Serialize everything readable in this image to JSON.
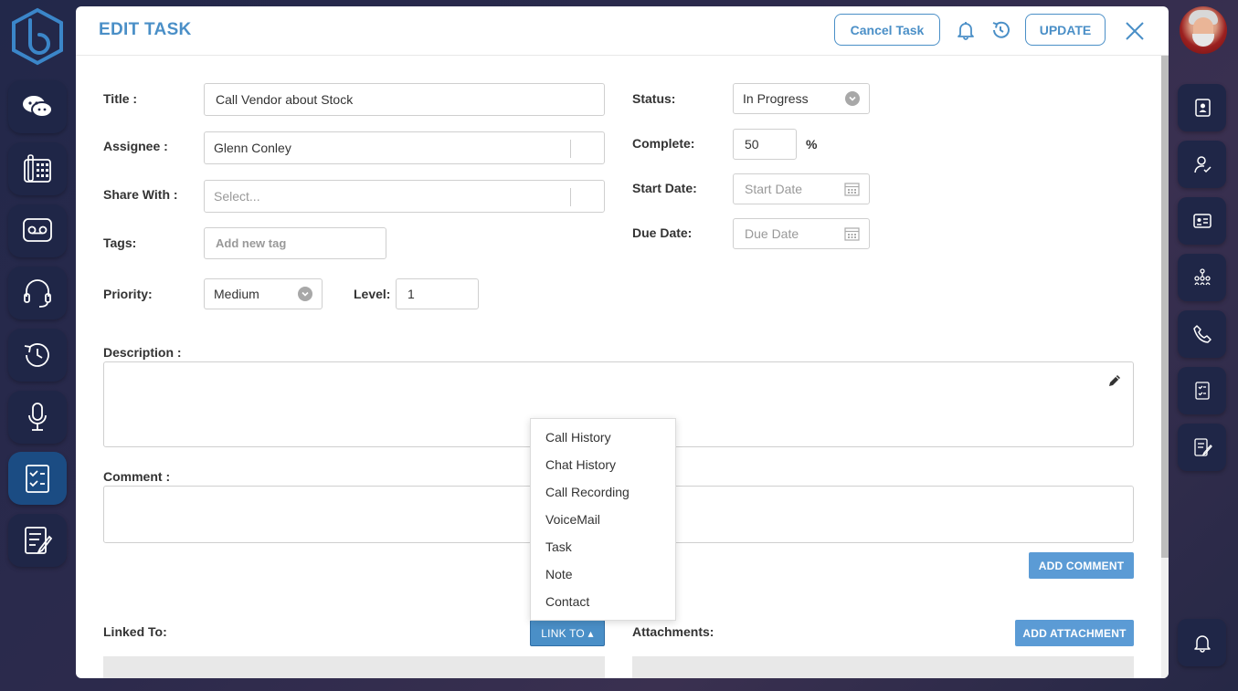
{
  "header": {
    "title": "EDIT TASK",
    "cancel_label": "Cancel Task",
    "update_label": "UPDATE"
  },
  "form": {
    "title_label": "Title :",
    "title_value": "Call Vendor about Stock",
    "assignee_label": "Assignee :",
    "assignee_value": "Glenn Conley",
    "share_label": "Share With :",
    "share_placeholder": "Select...",
    "tags_label": "Tags:",
    "tags_placeholder": "Add new tag",
    "priority_label": "Priority:",
    "priority_value": "Medium",
    "level_label": "Level:",
    "level_value": "1",
    "status_label": "Status:",
    "status_value": "In Progress",
    "complete_label": "Complete:",
    "complete_value": "50",
    "complete_unit": "%",
    "start_label": "Start Date:",
    "start_placeholder": "Start Date",
    "due_label": "Due Date:",
    "due_placeholder": "Due Date",
    "description_label": "Description :",
    "comment_label": "Comment :",
    "add_comment_label": "ADD COMMENT",
    "linked_label": "Linked To:",
    "link_to_label": "LINK TO ▴",
    "attachments_label": "Attachments:",
    "add_attachment_label": "ADD ATTACHMENT"
  },
  "link_menu": {
    "items": [
      "Call History",
      "Chat History",
      "Call Recording",
      "VoiceMail",
      "Task",
      "Note",
      "Contact"
    ]
  },
  "left_nav": [
    "chat-icon",
    "dialpad-icon",
    "voicemail-icon",
    "headset-icon",
    "history-icon",
    "microphone-icon",
    "tasks-icon",
    "notes-icon"
  ],
  "right_nav": [
    "contacts-book-icon",
    "user-check-icon",
    "id-card-icon",
    "org-chart-icon",
    "phone-icon",
    "checklist-icon",
    "edit-note-icon",
    "bell-icon"
  ],
  "colors": {
    "accent": "#4a8fc7",
    "button_blue": "#5b9bd5",
    "sidebar_tile": "#1f2647",
    "sidebar_active": "#1b4c83"
  }
}
